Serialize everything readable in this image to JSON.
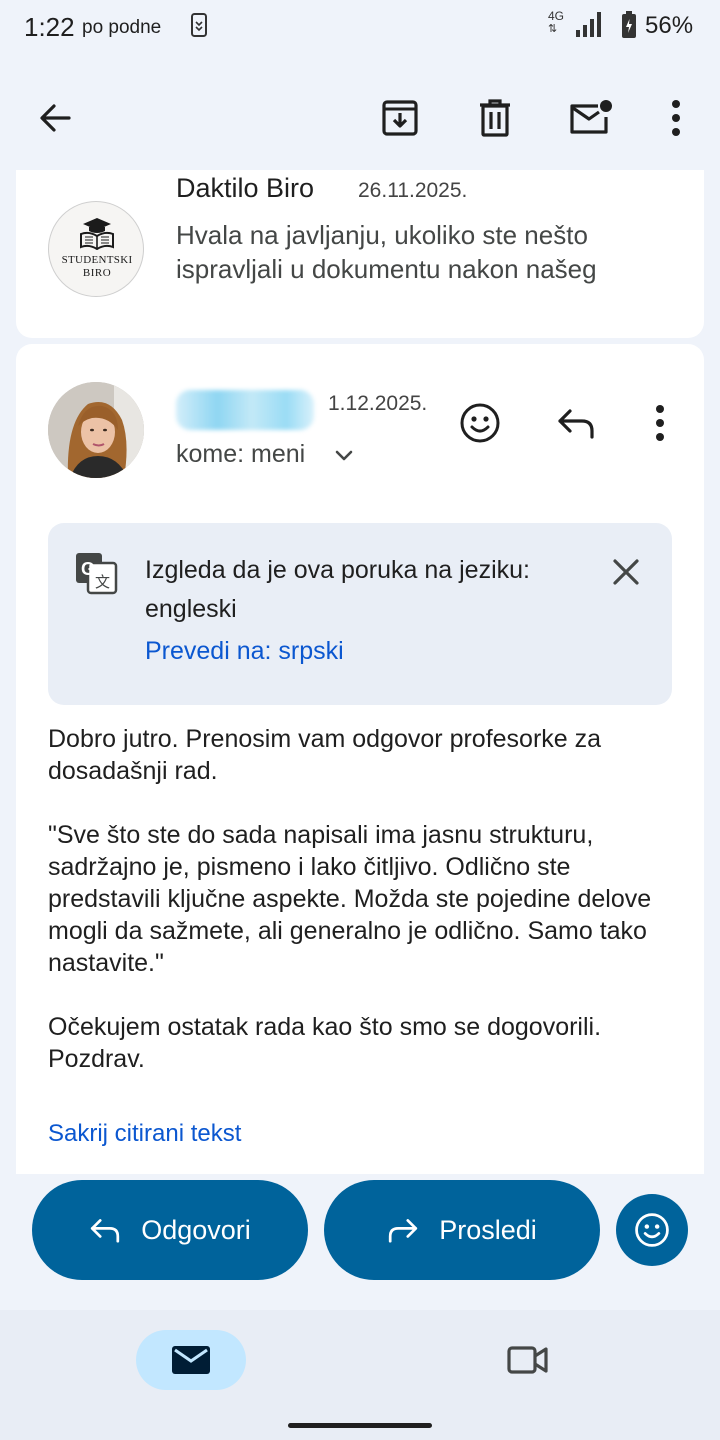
{
  "status_bar": {
    "time": "1:22",
    "ampm": "po podne",
    "network": "4G",
    "battery": "56%"
  },
  "toolbar": {
    "back_icon": "arrow-back-icon",
    "archive_icon": "archive-icon",
    "delete_icon": "trash-icon",
    "unread_icon": "mark-unread-icon",
    "more_icon": "more-vert-icon"
  },
  "previous_message": {
    "logo_text_top": "STUDENTSKI",
    "logo_text_bottom": "BIRO",
    "sender": "Daktilo Biro",
    "date": "26.11.2025.",
    "snippet": "Hvala na javljanju, ukoliko ste nešto ispravljali u dokumentu nakon našeg"
  },
  "current_message": {
    "date": "1.12.2025.",
    "to_line": "kome: meni",
    "translate": {
      "text": "Izgleda da je ova poruka na jeziku: engleski",
      "link": "Prevedi na: srpski"
    },
    "body": {
      "p1": "Dobro jutro. Prenosim vam odgovor profesorke za dosadašnji rad.",
      "p2": "\"Sve što ste do sada napisali ima jasnu strukturu, sadržajno je, pismeno i lako čitljivo. Odlično ste predstavili ključne aspekte. Možda ste pojedine delove mogli da sažmete, ali generalno je odlično. Samo tako nastavite.\"",
      "p3": "Očekujem ostatak rada kao što smo se dogovorili. Pozdrav."
    },
    "hide_quoted": "Sakrij citirani tekst"
  },
  "actions": {
    "reply": "Odgovori",
    "forward": "Prosledi"
  },
  "colors": {
    "primary": "#00639b",
    "link": "#0b57d0",
    "background": "#eff3fa",
    "nav_active": "#c2e7ff"
  }
}
